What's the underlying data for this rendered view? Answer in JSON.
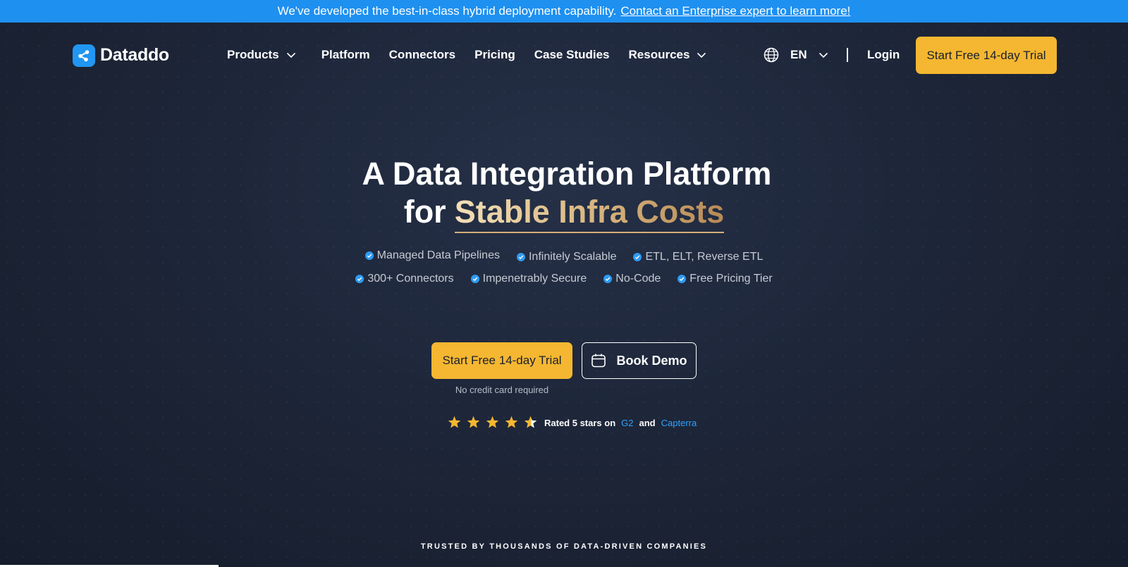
{
  "banner": {
    "text": "We've developed the best-in-class hybrid deployment capability.",
    "link_label": "Contact an Enterprise expert to learn more!"
  },
  "brand": {
    "name": "Dataddo",
    "accent": "#2196f3"
  },
  "nav": {
    "items": [
      {
        "label": "Products",
        "has_dropdown": true
      },
      {
        "label": "Platform",
        "has_dropdown": false
      },
      {
        "label": "Connectors",
        "has_dropdown": false
      },
      {
        "label": "Pricing",
        "has_dropdown": false
      },
      {
        "label": "Case Studies",
        "has_dropdown": false
      },
      {
        "label": "Resources",
        "has_dropdown": true
      }
    ],
    "language": "EN",
    "login": "Login",
    "cta": "Start Free 14-day Trial"
  },
  "hero": {
    "title_line1": "A Data Integration Platform",
    "title_line2_prefix": "for",
    "title_line2_highlight": "Stable Infra Costs",
    "features_row1": [
      "Managed Data Pipelines",
      "Infinitely Scalable",
      "ETL, ELT, Reverse ETL"
    ],
    "features_row2": [
      "300+ Connectors",
      "Impenetrably Secure",
      "No-Code",
      "Free Pricing Tier"
    ],
    "cta_primary": "Start Free 14-day Trial",
    "cta_note": "No credit card required",
    "cta_secondary": "Book Demo"
  },
  "rating": {
    "stars": 5,
    "text": "Rated 5 stars on",
    "link1": "G2",
    "and": "and",
    "link2": "Capterra"
  },
  "trusted": "TRUSTED BY THOUSANDS OF DATA-DRIVEN COMPANIES",
  "colors": {
    "banner": "#1e90f0",
    "cta": "#f5b731",
    "background": "#1b2233",
    "link": "#2ea3ff",
    "star": "#f5b731"
  }
}
